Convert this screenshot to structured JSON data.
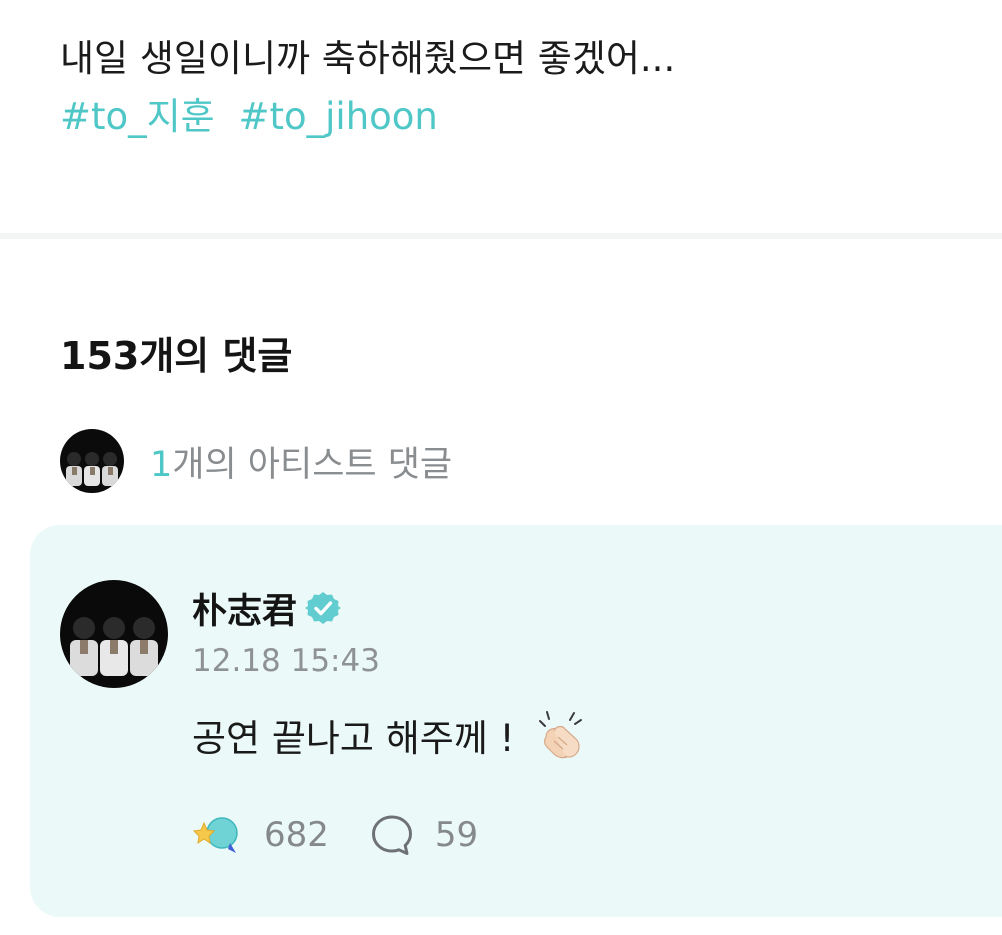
{
  "post": {
    "text": "내일 생일이니까 축하해줬으면 좋겠어...",
    "hashtags": [
      "#to_지훈",
      "#to_jihoon"
    ]
  },
  "comments": {
    "count_label": "153개의 댓글",
    "artist_count": "1",
    "artist_label_suffix": "개의 아티스트 댓글"
  },
  "artist_comment": {
    "author": "朴志君",
    "timestamp": "12.18 15:43",
    "text": "공연 끝나고 해주께 !",
    "likes": "682",
    "replies": "59"
  },
  "colors": {
    "accent": "#4fc7c7",
    "card_background": "#ebfaf8",
    "muted_text": "#8a8d90"
  },
  "icons": {
    "verified": "verified-badge-icon",
    "clap": "clapping-hands-icon",
    "reaction": "reaction-icon",
    "reply": "speech-bubble-icon"
  }
}
